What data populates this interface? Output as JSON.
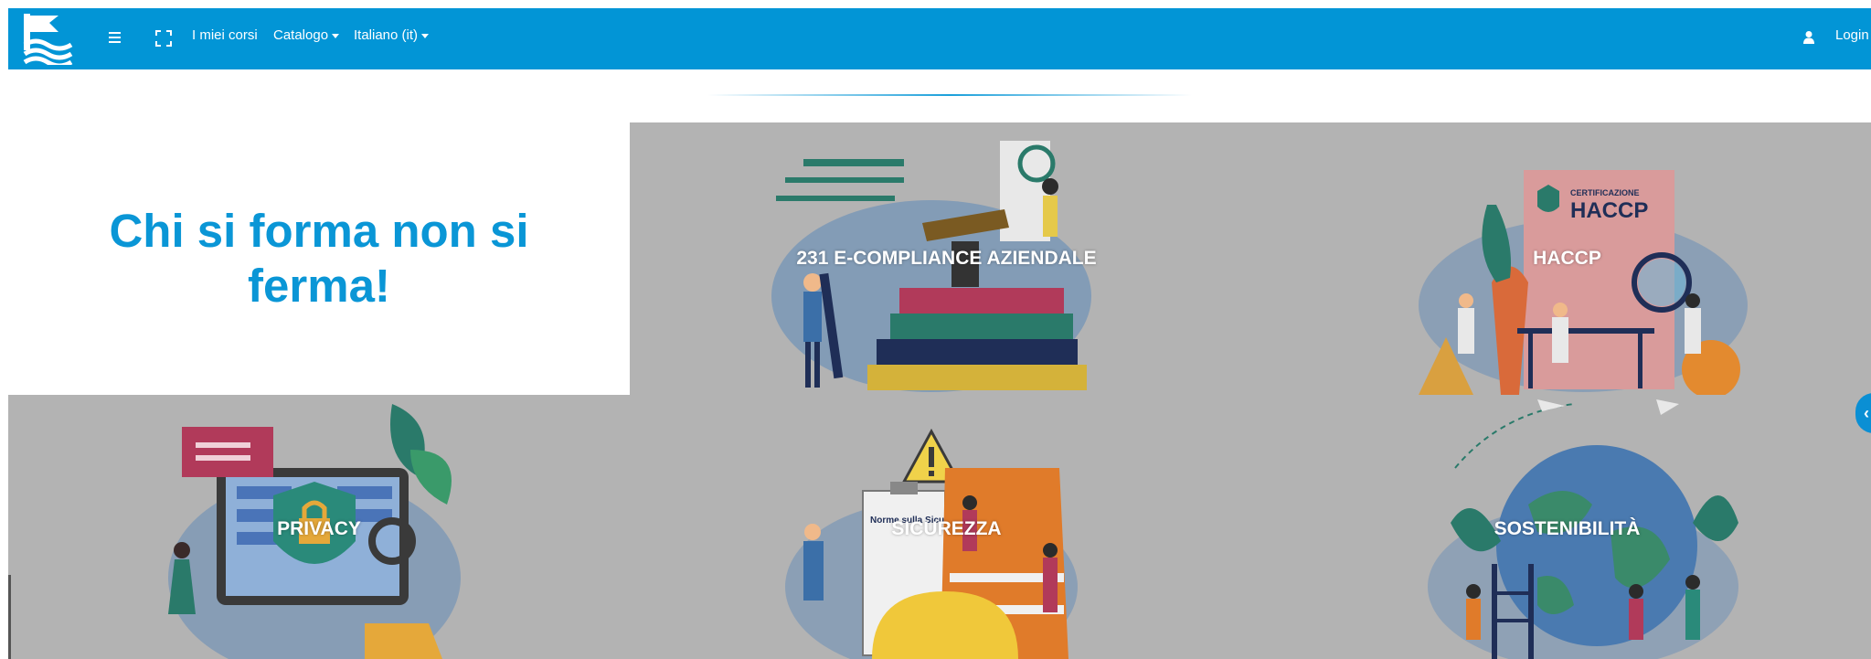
{
  "navbar": {
    "menu_icon": "hamburger-icon",
    "fullscreen_icon": "fullscreen-icon",
    "my_courses": "I miei corsi",
    "catalog": "Catalogo",
    "language": "Italiano (it)",
    "user_icon": "user-icon",
    "login": "Login",
    "color": "#0295d6"
  },
  "hero": {
    "title": "Chi si forma non si ferma!",
    "color": "#0a96d6"
  },
  "tiles": [
    {
      "label": "231 E-COMPLIANCE AZIENDALE"
    },
    {
      "label": "HACCP",
      "badge_title": "CERTIFICAZIONE",
      "badge_text": "HACCP"
    },
    {
      "label": "PRIVACY"
    },
    {
      "label": "SICUREZZA",
      "clipboard_text": "Norme sulla Sicur"
    },
    {
      "label": "SOSTENIBILITÀ"
    }
  ],
  "side_tab": {
    "icon": "chevron-left-icon"
  }
}
